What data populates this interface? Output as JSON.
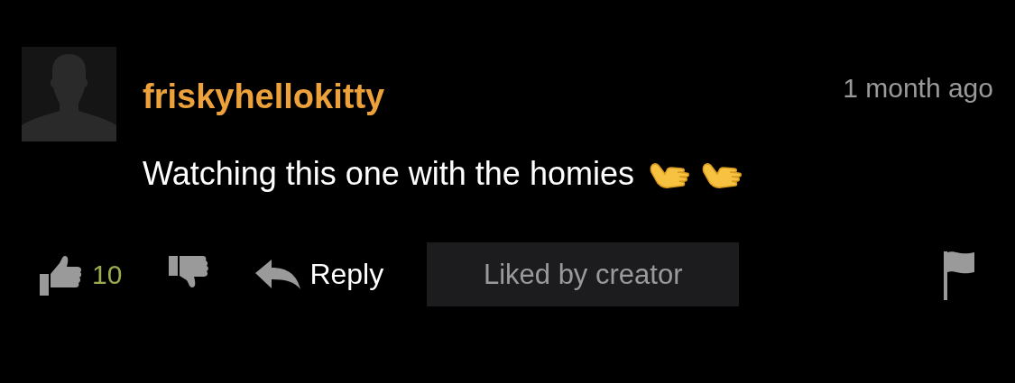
{
  "comment": {
    "username": "friskyhellokitty",
    "time": "1 month ago",
    "text": "Watching this one with the homies",
    "likes": "10",
    "reply": "Reply",
    "badge": "Liked by creator"
  }
}
